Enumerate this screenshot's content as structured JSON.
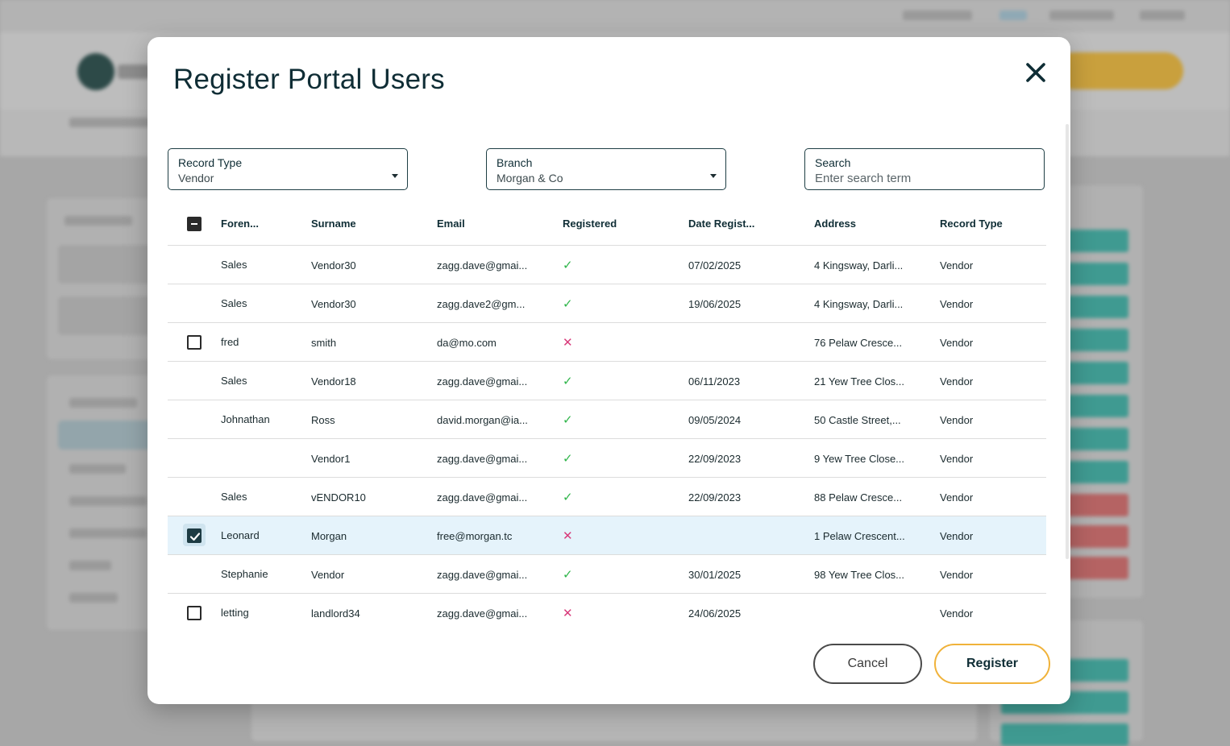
{
  "modal": {
    "title": "Register Portal Users",
    "close_icon": "close-icon"
  },
  "filters": {
    "record_type": {
      "label": "Record Type",
      "value": "Vendor"
    },
    "branch": {
      "label": "Branch",
      "value": "Morgan & Co"
    },
    "search": {
      "label": "Search",
      "placeholder": "Enter search term",
      "value": ""
    }
  },
  "table": {
    "columns": [
      "Foren...",
      "Surname",
      "Email",
      "Registered",
      "Date Regist...",
      "Address",
      "Record Type"
    ],
    "header_checkbox_state": "indeterminate",
    "rows": [
      {
        "checkbox": "none",
        "forename": "Sales",
        "surname": "Vendor30",
        "email": "zagg.dave@gmai...",
        "registered": "✓",
        "date": "07/02/2025",
        "address": "4 Kingsway, Darli...",
        "record_type": "Vendor"
      },
      {
        "checkbox": "none",
        "forename": "Sales",
        "surname": "Vendor30",
        "email": "zagg.dave2@gm...",
        "registered": "✓",
        "date": "19/06/2025",
        "address": "4 Kingsway, Darli...",
        "record_type": "Vendor"
      },
      {
        "checkbox": "unchecked",
        "forename": "fred",
        "surname": "smith",
        "email": "da@mo.com",
        "registered": "✕",
        "date": "",
        "address": "76 Pelaw Cresce...",
        "record_type": "Vendor"
      },
      {
        "checkbox": "none",
        "forename": "Sales",
        "surname": "Vendor18",
        "email": "zagg.dave@gmai...",
        "registered": "✓",
        "date": "06/11/2023",
        "address": "21 Yew Tree Clos...",
        "record_type": "Vendor"
      },
      {
        "checkbox": "none",
        "forename": "Johnathan",
        "surname": "Ross",
        "email": "david.morgan@ia...",
        "registered": "✓",
        "date": "09/05/2024",
        "address": "50 Castle Street,...",
        "record_type": "Vendor"
      },
      {
        "checkbox": "none",
        "forename": "",
        "surname": "Vendor1",
        "email": "zagg.dave@gmai...",
        "registered": "✓",
        "date": "22/09/2023",
        "address": "9 Yew Tree Close...",
        "record_type": "Vendor"
      },
      {
        "checkbox": "none",
        "forename": "Sales",
        "surname": "vENDOR10",
        "email": "zagg.dave@gmai...",
        "registered": "✓",
        "date": "22/09/2023",
        "address": "88 Pelaw Cresce...",
        "record_type": "Vendor"
      },
      {
        "checkbox": "checked",
        "forename": "Leonard",
        "surname": "Morgan",
        "email": "free@morgan.tc",
        "registered": "✕",
        "date": "",
        "address": "1 Pelaw Crescent...",
        "record_type": "Vendor"
      },
      {
        "checkbox": "none",
        "forename": "Stephanie",
        "surname": "Vendor",
        "email": "zagg.dave@gmai...",
        "registered": "✓",
        "date": "30/01/2025",
        "address": "98 Yew Tree Clos...",
        "record_type": "Vendor"
      },
      {
        "checkbox": "unchecked",
        "forename": "letting",
        "surname": "landlord34",
        "email": "zagg.dave@gmai...",
        "registered": "✕",
        "date": "24/06/2025",
        "address": "",
        "record_type": "Vendor"
      }
    ]
  },
  "actions": {
    "cancel_label": "Cancel",
    "register_label": "Register"
  },
  "colors": {
    "primary_dark": "#0f2d35",
    "register_border": "#f0b23a",
    "registered_yes": "#2fb54a",
    "registered_no": "#d83a7a",
    "selected_row": "#e5f3fb"
  }
}
